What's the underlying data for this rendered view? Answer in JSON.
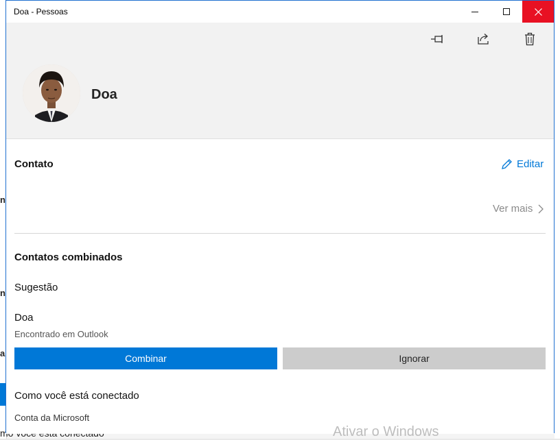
{
  "window": {
    "title": "Doa - Pessoas"
  },
  "header": {
    "name": "Doa",
    "icons": [
      "pin-icon",
      "share-icon",
      "trash-icon"
    ]
  },
  "contact": {
    "section_title": "Contato",
    "edit_label": "Editar",
    "see_more_label": "Ver mais"
  },
  "combined": {
    "section_title": "Contatos combinados",
    "suggestion_label": "Sugestão",
    "suggested_name": "Doa",
    "suggested_source": "Encontrado em Outlook",
    "combine_label": "Combinar",
    "ignore_label": "Ignorar"
  },
  "connection": {
    "section_title": "Como você está conectado",
    "account": "Conta da Microsoft"
  },
  "background": {
    "bottom_text": "mo você está conectado"
  },
  "watermark": "Ativar o Windows",
  "colors": {
    "accent": "#0078d7",
    "close_red": "#e81123",
    "header_bg": "#f2f2f2",
    "secondary_button": "#cccccc"
  }
}
